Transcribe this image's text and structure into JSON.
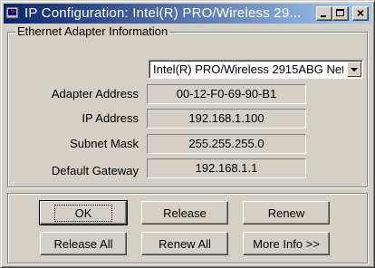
{
  "window": {
    "title": "IP Configuration: Intel(R) PRO/Wireless 29...",
    "icon": "help-network-icon"
  },
  "titlebar_buttons": {
    "minimize": "minimize-icon",
    "maximize": "maximize-icon",
    "close": "close-icon"
  },
  "group": {
    "label": "Ethernet  Adapter Information"
  },
  "adapter_select": {
    "selected": "Intel(R) PRO/Wireless 2915ABG Net"
  },
  "fields": [
    {
      "label": "Adapter Address",
      "value": "00-12-F0-69-90-B1"
    },
    {
      "label": "IP Address",
      "value": "192.168.1.100"
    },
    {
      "label": "Subnet Mask",
      "value": "255.255.255.0"
    },
    {
      "label": "Default Gateway",
      "value": "192.168.1.1"
    }
  ],
  "buttons": {
    "ok": "OK",
    "release": "Release",
    "renew": "Renew",
    "release_all": "Release All",
    "renew_all": "Renew All",
    "more_info": "More Info >>"
  },
  "colors": {
    "titlebar_start": "#0a246a",
    "titlebar_end": "#a6caf0",
    "face": "#d4d0c8"
  }
}
